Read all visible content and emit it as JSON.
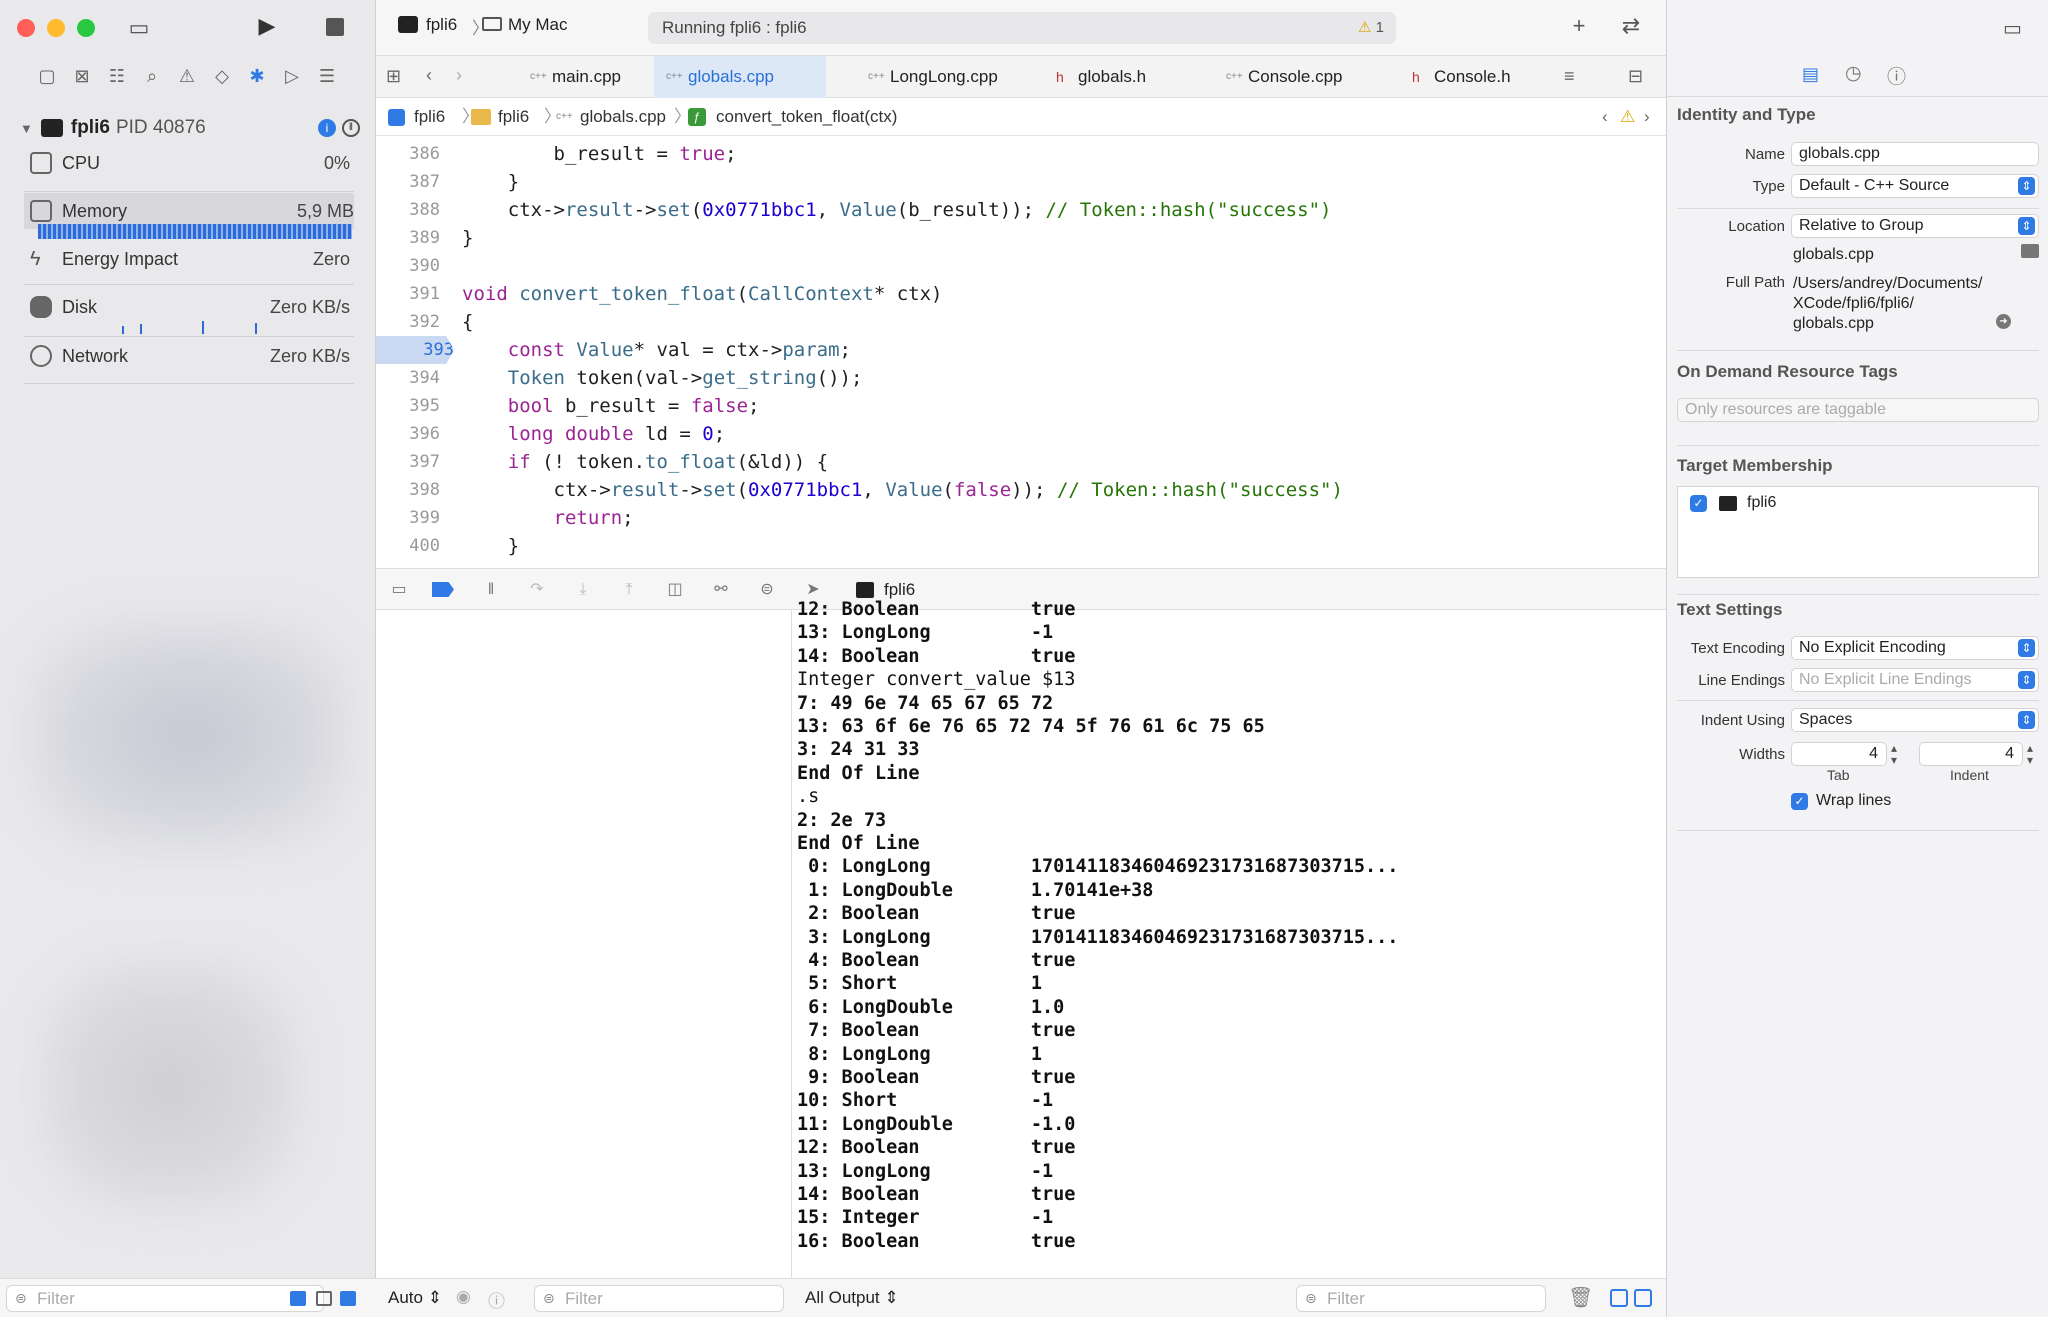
{
  "toolbar": {
    "scheme": "fpli6",
    "destination": "My Mac",
    "status": "Running fpli6 : fpli6",
    "warning_count": "1"
  },
  "tabs": [
    {
      "label": "main.cpp",
      "icon": "c++"
    },
    {
      "label": "globals.cpp",
      "icon": "c++"
    },
    {
      "label": "LongLong.cpp",
      "icon": "c++"
    },
    {
      "label": "globals.h",
      "icon": "h"
    },
    {
      "label": "Console.cpp",
      "icon": "c++"
    },
    {
      "label": "Console.h",
      "icon": "h"
    }
  ],
  "breadcrumbs": [
    "fpli6",
    "fpli6",
    "globals.cpp",
    "convert_token_float(ctx)"
  ],
  "debug_navigator": {
    "process": "fpli6",
    "pid": "PID 40876",
    "gauges": [
      {
        "label": "CPU",
        "value": "0%"
      },
      {
        "label": "Memory",
        "value": "5,9 MB"
      },
      {
        "label": "Energy Impact",
        "value": "Zero"
      },
      {
        "label": "Disk",
        "value": "Zero KB/s"
      },
      {
        "label": "Network",
        "value": "Zero KB/s"
      }
    ]
  },
  "editor": {
    "current_line": "393",
    "lines": [
      {
        "n": "386",
        "t": "        b_result = true;"
      },
      {
        "n": "387",
        "t": "    }"
      },
      {
        "n": "388",
        "t": "    ctx->result->set(0x0771bbc1, Value(b_result)); // Token::hash(\"success\")"
      },
      {
        "n": "389",
        "t": "}"
      },
      {
        "n": "390",
        "t": ""
      },
      {
        "n": "391",
        "t": "void convert_token_float(CallContext* ctx)"
      },
      {
        "n": "392",
        "t": "{"
      },
      {
        "n": "393",
        "t": "    const Value* val = ctx->param;"
      },
      {
        "n": "394",
        "t": "    Token token(val->get_string());"
      },
      {
        "n": "395",
        "t": "    bool b_result = false;"
      },
      {
        "n": "396",
        "t": "    long double ld = 0;"
      },
      {
        "n": "397",
        "t": "    if (! token.to_float(&ld)) {"
      },
      {
        "n": "398",
        "t": "        ctx->result->set(0x0771bbc1, Value(false)); // Token::hash(\"success\")"
      },
      {
        "n": "399",
        "t": "        return;"
      },
      {
        "n": "400",
        "t": "    }"
      }
    ]
  },
  "debug_bar": {
    "process": "fpli6"
  },
  "console": {
    "lines": [
      "12: Boolean          true",
      "13: LongLong         -1",
      "14: Boolean          true",
      "Integer convert_value $13",
      "7: 49 6e 74 65 67 65 72",
      "13: 63 6f 6e 76 65 72 74 5f 76 61 6c 75 65",
      "3: 24 31 33",
      "End Of Line",
      ".s",
      "2: 2e 73",
      "End Of Line",
      " 0: LongLong         170141183460469231731687303715...",
      " 1: LongDouble       1.70141e+38",
      " 2: Boolean          true",
      " 3: LongLong         170141183460469231731687303715...",
      " 4: Boolean          true",
      " 5: Short            1",
      " 6: LongDouble       1.0",
      " 7: Boolean          true",
      " 8: LongLong         1",
      " 9: Boolean          true",
      "10: Short            -1",
      "11: LongDouble       -1.0",
      "12: Boolean          true",
      "13: LongLong         -1",
      "14: Boolean          true",
      "15: Integer          -1",
      "16: Boolean          true"
    ]
  },
  "bottom": {
    "left_filter_placeholder": "Filter",
    "auto_label": "Auto",
    "vars_filter_placeholder": "Filter",
    "output_label": "All Output",
    "console_filter_placeholder": "Filter"
  },
  "inspector": {
    "identity_header": "Identity and Type",
    "name_label": "Name",
    "name_value": "globals.cpp",
    "type_label": "Type",
    "type_value": "Default - C++ Source",
    "location_label": "Location",
    "location_value": "Relative to Group",
    "location_file": "globals.cpp",
    "fullpath_label": "Full Path",
    "fullpath_lines": [
      "/Users/andrey/Documents/",
      "XCode/fpli6/fpli6/",
      "globals.cpp"
    ],
    "tags_header": "On Demand Resource Tags",
    "tags_placeholder": "Only resources are taggable",
    "membership_header": "Target Membership",
    "membership_target": "fpli6",
    "text_header": "Text Settings",
    "encoding_label": "Text Encoding",
    "encoding_value": "No Explicit Encoding",
    "endings_label": "Line Endings",
    "endings_value": "No Explicit Line Endings",
    "indent_label": "Indent Using",
    "indent_value": "Spaces",
    "widths_label": "Widths",
    "tab_value": "4",
    "indent_width_value": "4",
    "tab_label": "Tab",
    "indent_sub_label": "Indent",
    "wrap_label": "Wrap lines"
  }
}
